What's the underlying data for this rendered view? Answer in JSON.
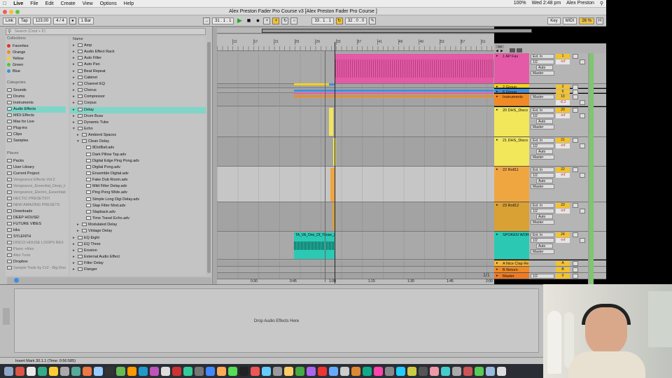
{
  "menubar": {
    "items": [
      "Live",
      "File",
      "Edit",
      "Create",
      "View",
      "Options",
      "Help"
    ],
    "right": [
      "100%",
      "Wed 2:48 pm",
      "Alex Preston"
    ]
  },
  "window": {
    "title": "Alex Preston Fader Pro Course  v3   [Alex Preston Fader Pro Course ]"
  },
  "transport": {
    "link": "Link",
    "tap": "Tap",
    "tempo": "123.00",
    "meter": "4 / 4",
    "quant": "1 Bar",
    "position": "31 .  1 .  1",
    "loop_start": "33 .  1 .  1",
    "loop_len": "32 .  0 .  0",
    "key": "Key",
    "midi": "MIDI",
    "cpu": "26 %"
  },
  "browser": {
    "search_placeholder": "Search (Cmd + F)",
    "collections_title": "Collections",
    "collections": [
      {
        "label": "Favorites",
        "color": "#e0342e"
      },
      {
        "label": "Orange",
        "color": "#f08a24"
      },
      {
        "label": "Yellow",
        "color": "#f2d21e"
      },
      {
        "label": "Green",
        "color": "#54c140"
      },
      {
        "label": "Blue",
        "color": "#3d8fe0"
      }
    ],
    "categories_title": "Categories",
    "categories": [
      "Sounds",
      "Drums",
      "Instruments",
      "Audio Effects",
      "MIDI Effects",
      "Max for Live",
      "Plug-ins",
      "Clips",
      "Samples"
    ],
    "places_title": "Places",
    "places": [
      "Packs",
      "User Library",
      "Current Project",
      "Vengeance Effects Vol.2",
      "Vengeance_Essential_Deep_Ho",
      "Vengeance_Electro_Essentials",
      "HECTIC PRESETS!!!",
      "NEW AMAZING PRESETS",
      "Downloads",
      "DEEP HOUSE!",
      "FUTURE VIBES",
      "kiks",
      "SYLENTH",
      "DISCO HOUSE LOOPS REX",
      "Piano +Alex",
      "Alex Tune",
      "Dropbox",
      "Sample Tools by Cr2 - Big Room"
    ],
    "name_header": "Name",
    "items": [
      {
        "label": "Amp",
        "level": 0,
        "type": "folder"
      },
      {
        "label": "Audio Effect Rack",
        "level": 0,
        "type": "folder"
      },
      {
        "label": "Auto Filter",
        "level": 0,
        "type": "folder"
      },
      {
        "label": "Auto Pan",
        "level": 0,
        "type": "folder"
      },
      {
        "label": "Beat Repeat",
        "level": 0,
        "type": "folder"
      },
      {
        "label": "Cabinet",
        "level": 0,
        "type": "folder"
      },
      {
        "label": "Channel EQ",
        "level": 0,
        "type": "folder"
      },
      {
        "label": "Chorus",
        "level": 0,
        "type": "folder"
      },
      {
        "label": "Compressor",
        "level": 0,
        "type": "folder"
      },
      {
        "label": "Corpus",
        "level": 0,
        "type": "folder"
      },
      {
        "label": "Delay",
        "level": 0,
        "type": "folder"
      },
      {
        "label": "Drum Buss",
        "level": 0,
        "type": "folder"
      },
      {
        "label": "Dynamic Tube",
        "level": 0,
        "type": "folder"
      },
      {
        "label": "Echo",
        "level": 0,
        "type": "open"
      },
      {
        "label": "Ambient Spaces",
        "level": 1,
        "type": "folder"
      },
      {
        "label": "Clean Delay",
        "level": 1,
        "type": "open"
      },
      {
        "label": "8DotBall.adv",
        "level": 2,
        "type": "file"
      },
      {
        "label": "Dark Pillow Tap.adv",
        "level": 2,
        "type": "file"
      },
      {
        "label": "Digital Edge Ping Pong.adv",
        "level": 2,
        "type": "file"
      },
      {
        "label": "Digital Pong.adv",
        "level": 2,
        "type": "file"
      },
      {
        "label": "Ensemble Digital.adv",
        "level": 2,
        "type": "file"
      },
      {
        "label": "Fake Dub Room.adv",
        "level": 2,
        "type": "file"
      },
      {
        "label": "Mild Filter Delay.adv",
        "level": 2,
        "type": "file"
      },
      {
        "label": "Ping Pong Wide.adv",
        "level": 2,
        "type": "file"
      },
      {
        "label": "Simple Long Digi Delay.adv",
        "level": 2,
        "type": "file"
      },
      {
        "label": "Slap Filter Mod.adv",
        "level": 2,
        "type": "file"
      },
      {
        "label": "Slapback.adv",
        "level": 2,
        "type": "file"
      },
      {
        "label": "Time Travel Echo.adv",
        "level": 2,
        "type": "file"
      },
      {
        "label": "Modulated Delay",
        "level": 1,
        "type": "folder"
      },
      {
        "label": "Vintage Delay",
        "level": 1,
        "type": "folder"
      },
      {
        "label": "EQ Eight",
        "level": 0,
        "type": "folder"
      },
      {
        "label": "EQ Three",
        "level": 0,
        "type": "folder"
      },
      {
        "label": "Erosion",
        "level": 0,
        "type": "folder"
      },
      {
        "label": "External Audio Effect",
        "level": 0,
        "type": "folder"
      },
      {
        "label": "Filter Delay",
        "level": 0,
        "type": "folder"
      },
      {
        "label": "Flanger",
        "level": 0,
        "type": "folder"
      }
    ]
  },
  "arrangement": {
    "bar_numbers": [
      "12",
      "17",
      "21",
      "25",
      "29",
      "33",
      "37",
      "41",
      "45",
      "49",
      "53",
      "57",
      "61"
    ],
    "time_marks": [
      "0:30",
      "0:45",
      "1:00",
      "1:15",
      "1:30",
      "1:45",
      "2:00"
    ],
    "page": "1/1",
    "spoken_clip_label": "TA_VA_One_Of_Those_2"
  },
  "tracks": [
    {
      "name": "1 AP Fav",
      "color": "#e45aa6",
      "num": "1",
      "vol": "-inf",
      "input": "Ext. In",
      "ch": "1/2",
      "out": "Master"
    },
    {
      "name": "2 Group",
      "color": "#f2d21e",
      "num": "2",
      "vol": "",
      "input": "",
      "ch": "",
      "out": ""
    },
    {
      "name": "6 Group",
      "color": "#3d8fe0",
      "num": "6",
      "vol": "",
      "input": "",
      "ch": "",
      "out": ""
    },
    {
      "name": "Instruments",
      "color": "#f08a24",
      "num": "10",
      "vol": "-8.3",
      "input": "",
      "ch": "",
      "out": "Master"
    },
    {
      "name": "20 DHS_Disco",
      "color": "#f2e65a",
      "num": "20",
      "vol": "-inf",
      "input": "Ext. In",
      "ch": "1/2",
      "out": "Master"
    },
    {
      "name": "21 DHS_Disco",
      "color": "#f2e65a",
      "num": "21",
      "vol": "-inf",
      "input": "Ext. In",
      "ch": "1/2",
      "out": "Master"
    },
    {
      "name": "22 Roll11",
      "color": "#f0a640",
      "num": "22",
      "vol": "-inf",
      "input": "Ext. In",
      "ch": "1/2",
      "out": "Master"
    },
    {
      "name": "23 Roll12",
      "color": "#d9a033",
      "num": "23",
      "vol": "-inf",
      "input": "Ext. In",
      "ch": "1/2",
      "out": "Master"
    },
    {
      "name": "SPOKEN WORD",
      "color": "#2bc9b4",
      "num": "24",
      "vol": "-inf",
      "input": "Ext. In",
      "ch": "1/2",
      "out": "Master"
    },
    {
      "name": "A Nice Clap Re",
      "color": "#f2b63a",
      "num": "A",
      "vol": "",
      "input": "",
      "ch": "",
      "out": ""
    },
    {
      "name": "B Return",
      "color": "#f08a24",
      "num": "B",
      "vol": "",
      "input": "",
      "ch": "",
      "out": ""
    },
    {
      "name": "Master",
      "color": "#f07a24",
      "num": "0",
      "vol": "",
      "input": "",
      "ch": "1/2",
      "out": ""
    }
  ],
  "mixer": {
    "ext_in": "Ext. In",
    "auto": "Auto",
    "master": "Master",
    "post": "Post",
    "inf": "-inf",
    "zero": "0",
    "c": "C",
    "in": "In",
    "off": "Off",
    "value_minus83": "-8.3",
    "value_minus10": "-10.0"
  },
  "detail": {
    "drop_text": "Drop Audio Effects Here"
  },
  "status": {
    "text": "Insert Mark 30.1.1 (Time: 0:56:585)"
  }
}
